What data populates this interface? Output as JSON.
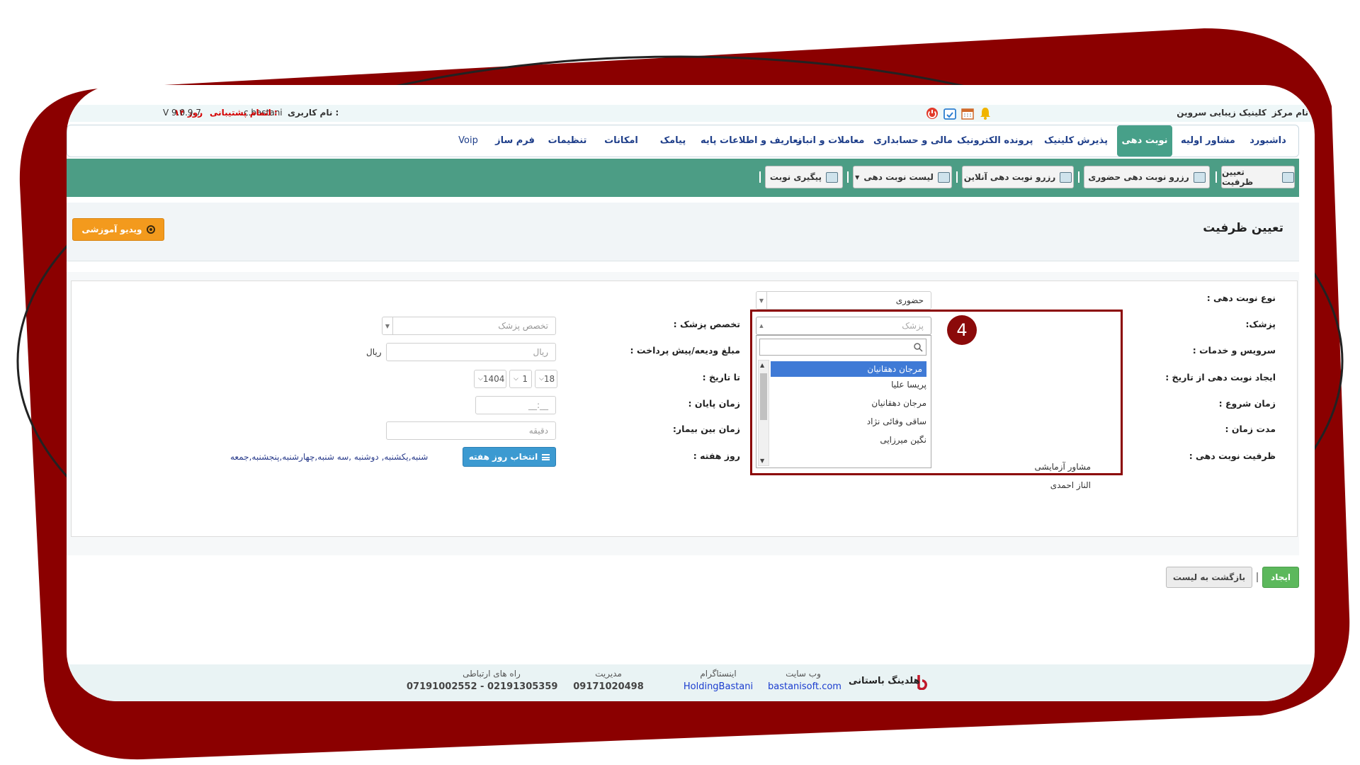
{
  "topbar": {
    "center_label": "نام مرکز :",
    "center_name": "کلینیک زیبایی سروین",
    "username_label": "نام کاربری :",
    "username": "c.bastani",
    "support_label": "اتمام پشتیبانی :",
    "support_value": "۱۴ روز",
    "version": "V 9.0.9.7"
  },
  "nav": {
    "items": [
      {
        "label": "داشبورد"
      },
      {
        "label": "مشاور اولیه"
      },
      {
        "label": "نوبت دهی"
      },
      {
        "label": "پذیرش کلینیک"
      },
      {
        "label": "پرونده الکترونیک"
      },
      {
        "label": "مالی و حسابداری"
      },
      {
        "label": "معاملات و انبار"
      },
      {
        "label": "تعاریف و اطلاعات پایه"
      },
      {
        "label": "پیامک"
      },
      {
        "label": "امکانات"
      },
      {
        "label": "تنظیمات"
      },
      {
        "label": "فرم ساز"
      },
      {
        "label": "Voip"
      }
    ]
  },
  "toolbar": {
    "buttons": [
      {
        "label": "تعیین ظرفیت"
      },
      {
        "label": "رزرو نوبت دهی حضوری"
      },
      {
        "label": "رزرو نوبت دهی آنلاین"
      },
      {
        "label": "لیست نوبت دهی"
      },
      {
        "label": "پیگیری نوبت"
      }
    ]
  },
  "header": {
    "title": "تعیین ظرفیت",
    "video_button": "ویدیو آموزشی"
  },
  "form": {
    "right": {
      "appointment_type_label": "نوع نوبت دهی :",
      "appointment_type_value": "حضوری",
      "doctor_label": "پزشک:",
      "doctor_placeholder": "پزشک",
      "services_label": "سرویس و خدمات :",
      "from_date_label": "ایجاد نوبت دهی از تاریخ :",
      "start_time_label": "زمان شروع :",
      "duration_label": "مدت زمان :",
      "capacity_label": "ظرفیت نوبت دهی :"
    },
    "left": {
      "specialty_label": "تخصص پزشک :",
      "specialty_placeholder": "تخصص پزشک",
      "deposit_label": "مبلغ ودیعه/پیش پرداخت :",
      "deposit_placeholder": "ریال",
      "deposit_unit": "ریال",
      "to_date_label": "تا تاریخ :",
      "to_date_day": "18",
      "to_date_month": "1",
      "to_date_year": "1404",
      "end_time_label": "زمان پایان :",
      "end_time_placeholder": "__:__",
      "between_patients_label": "زمان بین بیمار:",
      "between_patients_placeholder": "دقیقه",
      "weekday_label": "روز هفته :",
      "weekday_button": "انتخاب روز هفته",
      "weekdays_selected": "شنبه,یکشنبه, دوشنبه ,سه شنبه,چهارشنبه,پنجشنبه,جمعه"
    }
  },
  "doctor_dropdown": {
    "items": [
      {
        "label": "مرجان دهقانیان",
        "selected": true
      },
      {
        "label": "پریسا علیا",
        "selected": false
      },
      {
        "label": "مرجان دهقانیان",
        "selected": false
      },
      {
        "label": "ساقی وفائی نژاد",
        "selected": false
      },
      {
        "label": "نگین میرزایی",
        "selected": false
      },
      {
        "label": "مشاور آزمایشی",
        "selected": false
      },
      {
        "label": "الناز احمدی",
        "selected": false
      }
    ],
    "step_number": "4"
  },
  "actions": {
    "create": "ایجاد",
    "back": "بازگشت به لیست"
  },
  "footer": {
    "brand": "هلدینگ باستانی",
    "website_caption": "وب سایت",
    "website_value": "bastanisoft.com",
    "instagram_caption": "اینستاگرام",
    "instagram_value": "HoldingBastani",
    "management_caption": "مدیریت",
    "management_value": "09171020498",
    "contact_caption": "راه های ارتباطی",
    "contact_value": "07191002552 - 02191305359"
  },
  "colors": {
    "frame": "#8b0000",
    "toolbar_green": "#4c9d85",
    "nav_active": "#47a089",
    "video_orange": "#f39a1d",
    "create_green": "#5cb85c",
    "select_blue": "#3f7ad6"
  }
}
